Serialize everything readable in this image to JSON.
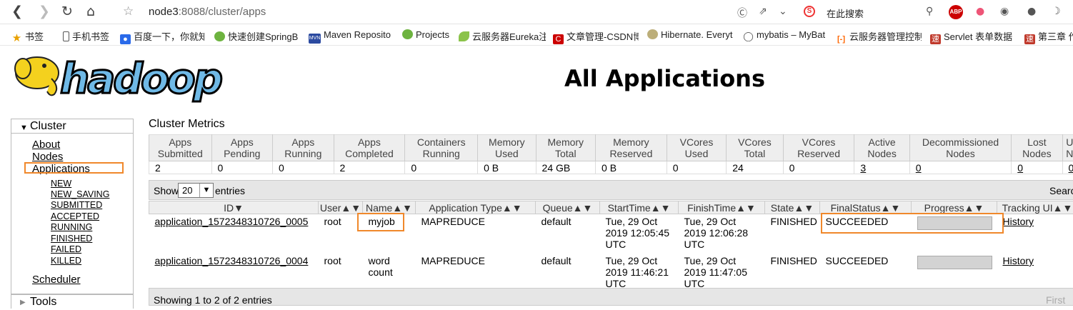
{
  "browser": {
    "url_host": "node3",
    "url_rest": ":8088/cluster/apps",
    "search_placeholder": "在此搜索",
    "bookmarks": [
      "书签",
      "手机书签",
      "百度一下，你就知",
      "快速创建SpringB",
      "Maven Reposito",
      "Projects",
      "云服务器Eureka注",
      "文章管理-CSDN博",
      "Hibernate. Everyt",
      "mybatis – MyBat",
      "云服务器管理控制",
      "Servlet 表单数据",
      "第三章 作"
    ]
  },
  "page": {
    "title": "All Applications",
    "logo_text": "hadoop"
  },
  "sidebar": {
    "cluster_label": "Cluster",
    "links": [
      "About",
      "Nodes",
      "Applications"
    ],
    "states": [
      "NEW",
      "NEW_SAVING",
      "SUBMITTED",
      "ACCEPTED",
      "RUNNING",
      "FINISHED",
      "FAILED",
      "KILLED"
    ],
    "scheduler": "Scheduler",
    "tools_label": "Tools"
  },
  "metrics": {
    "label": "Cluster Metrics",
    "headers": [
      [
        "Apps",
        "Submitted"
      ],
      [
        "Apps",
        "Pending"
      ],
      [
        "Apps",
        "Running"
      ],
      [
        "Apps",
        "Completed"
      ],
      [
        "Containers",
        "Running"
      ],
      [
        "Memory",
        "Used"
      ],
      [
        "Memory",
        "Total"
      ],
      [
        "Memory",
        "Reserved"
      ],
      [
        "VCores",
        "Used"
      ],
      [
        "VCores",
        "Total"
      ],
      [
        "VCores",
        "Reserved"
      ],
      [
        "Active",
        "Nodes"
      ],
      [
        "Decommissioned",
        "Nodes"
      ],
      [
        "Lost",
        "Nodes"
      ],
      [
        "U",
        "N"
      ]
    ],
    "values": [
      "2",
      "0",
      "0",
      "2",
      "0",
      "0 B",
      "24 GB",
      "0 B",
      "0",
      "24",
      "0",
      "3",
      "0",
      "0",
      "0"
    ]
  },
  "table_controls": {
    "show": "Show",
    "page_size": "20",
    "entries": "entries",
    "search": "Search",
    "footer": "Showing 1 to 2 of 2 entries",
    "first": "First"
  },
  "apps": {
    "headers": [
      "ID",
      "User",
      "Name",
      "Application Type",
      "Queue",
      "StartTime",
      "FinishTime",
      "State",
      "FinalStatus",
      "Progress",
      "Tracking UI"
    ],
    "rows": [
      {
        "id": "application_1572348310726_0005",
        "user": "root",
        "name": "myjob",
        "type": "MAPREDUCE",
        "queue": "default",
        "start": "Tue, 29 Oct 2019 12:05:45 UTC",
        "finish": "Tue, 29 Oct 2019 12:06:28 UTC",
        "state": "FINISHED",
        "final": "SUCCEEDED",
        "progress": 1.0,
        "tracking": "History"
      },
      {
        "id": "application_1572348310726_0004",
        "user": "root",
        "name": "word count",
        "type": "MAPREDUCE",
        "queue": "default",
        "start": "Tue, 29 Oct 2019 11:46:21 UTC",
        "finish": "Tue, 29 Oct 2019 11:47:05 UTC",
        "state": "FINISHED",
        "final": "SUCCEEDED",
        "progress": 1.0,
        "tracking": "History"
      }
    ]
  }
}
